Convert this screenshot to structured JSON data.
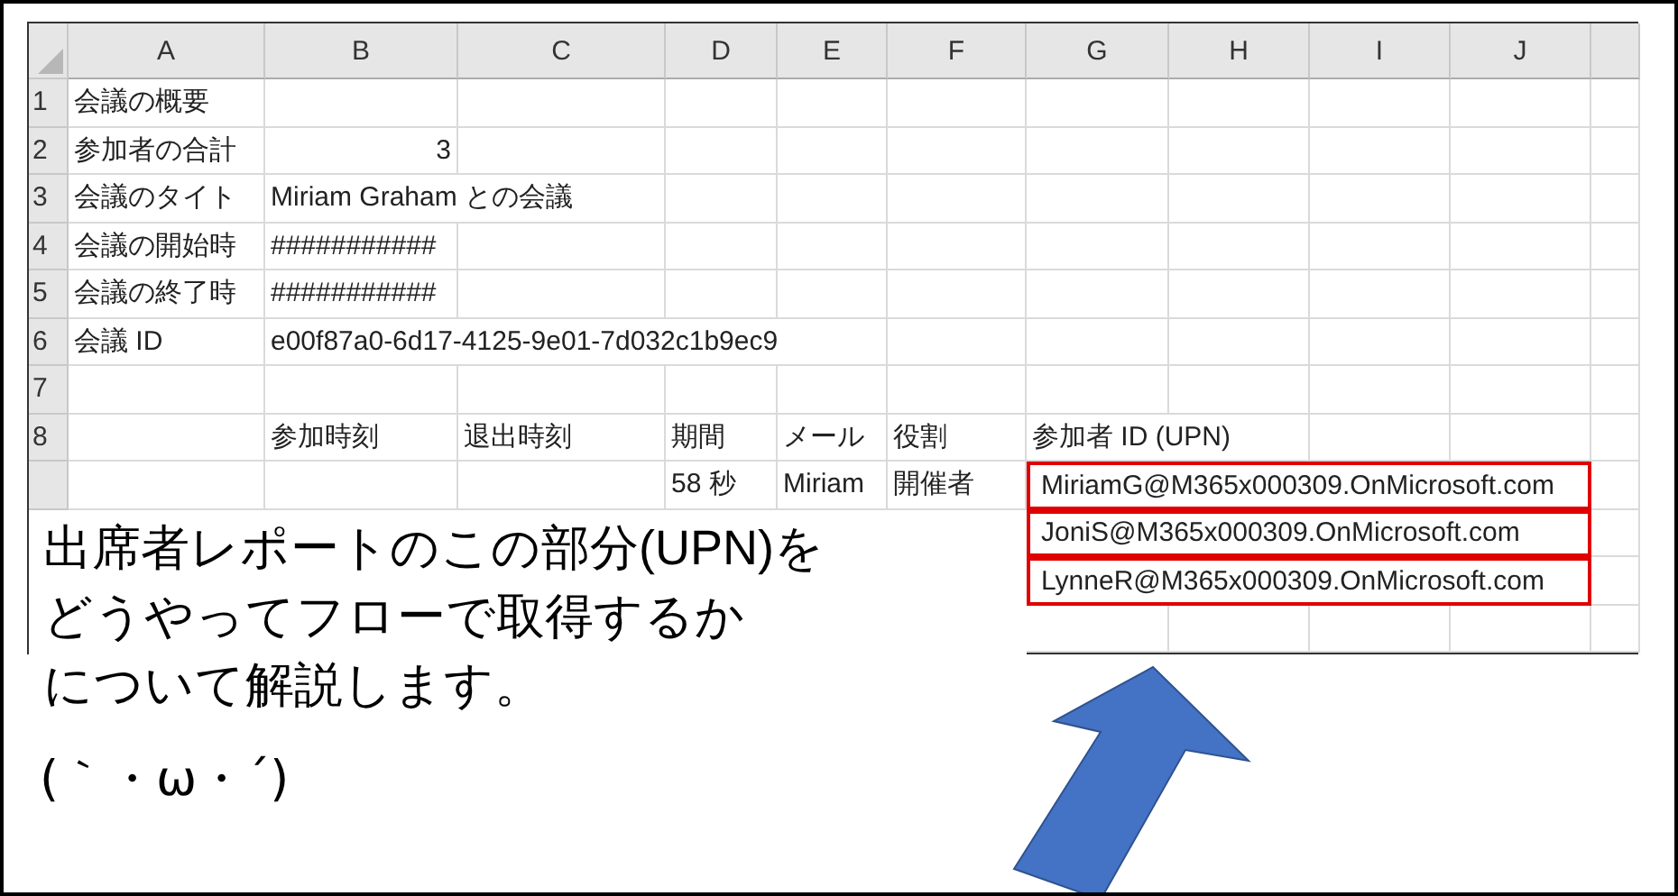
{
  "sheet": {
    "columns": [
      "A",
      "B",
      "C",
      "D",
      "E",
      "F",
      "G",
      "H",
      "I",
      "J"
    ],
    "rows": [
      {
        "number": "1",
        "cells": [
          {
            "text": "会議の概要"
          },
          {},
          {},
          {},
          {},
          {},
          {},
          {},
          {},
          {}
        ]
      },
      {
        "number": "2",
        "cells": [
          {
            "text": "参加者の合計"
          },
          {
            "text": "3",
            "kind": "number"
          },
          {},
          {},
          {},
          {},
          {},
          {},
          {},
          {}
        ]
      },
      {
        "number": "3",
        "cells": [
          {
            "text": "会議のタイト"
          },
          {
            "text": "Miriam Graham との会議"
          },
          {},
          {},
          {},
          {},
          {},
          {},
          {},
          {}
        ]
      },
      {
        "number": "4",
        "cells": [
          {
            "text": "会議の開始時"
          },
          {
            "text": "###########"
          },
          {},
          {},
          {},
          {},
          {},
          {},
          {},
          {}
        ]
      },
      {
        "number": "5",
        "cells": [
          {
            "text": "会議の終了時"
          },
          {
            "text": "###########"
          },
          {},
          {},
          {},
          {},
          {},
          {},
          {},
          {}
        ]
      },
      {
        "number": "6",
        "cells": [
          {
            "text": "会議 ID"
          },
          {
            "text": "e00f87a0-6d17-4125-9e01-7d032c1b9ec9"
          },
          {},
          {},
          {},
          {},
          {},
          {},
          {},
          {}
        ]
      },
      {
        "number": "7",
        "cells": [
          {},
          {},
          {},
          {},
          {},
          {},
          {},
          {},
          {},
          {}
        ]
      },
      {
        "number": "8",
        "cells": [
          {},
          {
            "text": "参加時刻"
          },
          {
            "text": "退出時刻"
          },
          {
            "text": "期間"
          },
          {
            "text": "メール"
          },
          {
            "text": "役割"
          },
          {
            "text": "参加者 ID (UPN)"
          },
          {},
          {},
          {}
        ]
      },
      {
        "cells": [
          {},
          {},
          {},
          {
            "text": "58 秒"
          },
          {
            "text": "Miriam"
          },
          {
            "text": "開催者"
          },
          {
            "text": "MiriamG@M365x000309.OnMicrosoft.com",
            "highlighted": true
          },
          {},
          {},
          {}
        ]
      },
      {
        "cells": [
          {},
          {},
          {},
          {},
          {},
          {},
          {
            "text": "JoniS@M365x000309.OnMicrosoft.com",
            "highlighted": true
          },
          {},
          {},
          {}
        ]
      },
      {
        "cells": [
          {},
          {},
          {},
          {},
          {},
          {},
          {
            "text": "LynneR@M365x000309.OnMicrosoft.com",
            "highlighted": true
          },
          {},
          {},
          {}
        ]
      },
      {
        "cells": [
          {},
          {},
          {},
          {},
          {},
          {},
          {},
          {},
          {},
          {}
        ]
      }
    ]
  },
  "callout": {
    "lines": [
      "出席者レポートのこの部分(UPN)を",
      "どうやってフローで取得するか",
      "について解説します。"
    ],
    "emoticon": "(｀・ω・´)"
  }
}
